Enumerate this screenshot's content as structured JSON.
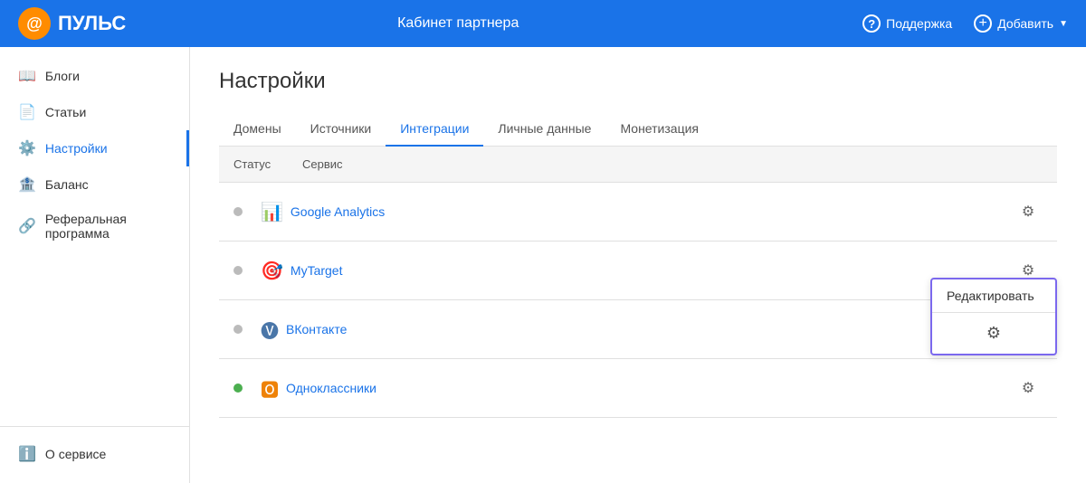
{
  "header": {
    "logo_text": "ПУЛЬС",
    "center_title": "Кабинет партнера",
    "support_label": "Поддержка",
    "add_label": "Добавить"
  },
  "sidebar": {
    "items": [
      {
        "id": "blogs",
        "label": "Блоги",
        "icon": "📖",
        "active": false
      },
      {
        "id": "articles",
        "label": "Статьи",
        "icon": "📄",
        "active": false
      },
      {
        "id": "settings",
        "label": "Настройки",
        "icon": "⚙️",
        "active": true
      },
      {
        "id": "balance",
        "label": "Баланс",
        "icon": "🏦",
        "active": false
      },
      {
        "id": "referral",
        "label": "Реферальная программа",
        "icon": "🔗",
        "active": false
      }
    ],
    "bottom_items": [
      {
        "id": "about",
        "label": "О сервисе",
        "icon": "ℹ️"
      }
    ]
  },
  "page": {
    "title": "Настройки"
  },
  "tabs": [
    {
      "id": "domains",
      "label": "Домены",
      "active": false
    },
    {
      "id": "sources",
      "label": "Источники",
      "active": false
    },
    {
      "id": "integrations",
      "label": "Интеграции",
      "active": true
    },
    {
      "id": "personal",
      "label": "Личные данные",
      "active": false
    },
    {
      "id": "monetization",
      "label": "Монетизация",
      "active": false
    }
  ],
  "table": {
    "headers": {
      "status": "Статус",
      "service": "Сервис"
    },
    "rows": [
      {
        "id": "google-analytics",
        "name": "Google Analytics",
        "status": "inactive",
        "icon_type": "ga"
      },
      {
        "id": "mytarget",
        "name": "MyTarget",
        "status": "inactive",
        "icon_type": "mytarget",
        "has_popup": true
      },
      {
        "id": "vkontakte",
        "name": "ВКонтакте",
        "status": "inactive",
        "icon_type": "vk"
      },
      {
        "id": "odnoklassniki",
        "name": "Одноклассники",
        "status": "active",
        "icon_type": "ok"
      }
    ]
  },
  "popup": {
    "edit_label": "Редактировать"
  }
}
